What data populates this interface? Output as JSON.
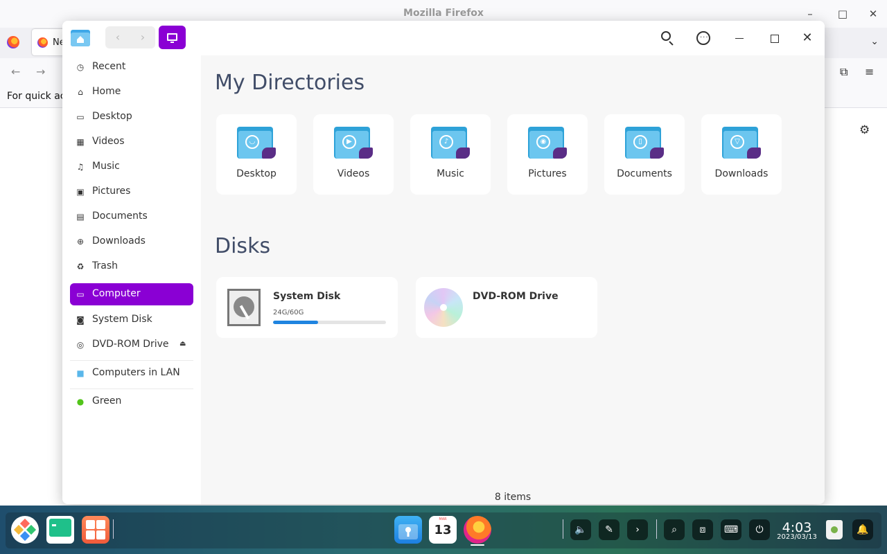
{
  "firefox": {
    "title": "Mozilla Firefox",
    "tab_label": "Ne",
    "bookmarks_text": "For quick acc"
  },
  "file_manager": {
    "sidebar": {
      "items": [
        {
          "label": "Recent",
          "icon": "clock-icon"
        },
        {
          "label": "Home",
          "icon": "home-icon"
        },
        {
          "label": "Desktop",
          "icon": "desktop-icon"
        },
        {
          "label": "Videos",
          "icon": "film-icon"
        },
        {
          "label": "Music",
          "icon": "music-note-icon"
        },
        {
          "label": "Pictures",
          "icon": "image-icon"
        },
        {
          "label": "Documents",
          "icon": "document-icon"
        },
        {
          "label": "Downloads",
          "icon": "download-icon"
        },
        {
          "label": "Trash",
          "icon": "trash-icon"
        },
        {
          "label": "Computer",
          "icon": "monitor-icon",
          "active": true
        },
        {
          "label": "System Disk",
          "icon": "disk-icon"
        },
        {
          "label": "DVD-ROM Drive",
          "icon": "dvd-icon"
        },
        {
          "label": "Computers in LAN",
          "icon": "network-folder-icon"
        },
        {
          "label": "Green",
          "icon": "green-tag-icon"
        }
      ]
    },
    "main": {
      "directories_title": "My Directories",
      "directories": [
        {
          "label": "Desktop",
          "icon": "desktop-folder-icon"
        },
        {
          "label": "Videos",
          "icon": "videos-folder-icon"
        },
        {
          "label": "Music",
          "icon": "music-folder-icon"
        },
        {
          "label": "Pictures",
          "icon": "pictures-folder-icon"
        },
        {
          "label": "Documents",
          "icon": "documents-folder-icon"
        },
        {
          "label": "Downloads",
          "icon": "downloads-folder-icon"
        }
      ],
      "disks_title": "Disks",
      "disks": [
        {
          "name": "System Disk",
          "usage": "24G/60G",
          "used_fraction": 0.4
        },
        {
          "name": "DVD-ROM Drive"
        }
      ],
      "status": "8 items"
    },
    "accent_color": "#8a00d4"
  },
  "dock": {
    "calendar_day": "13",
    "calendar_month": "MAR",
    "clock_time": "4:03",
    "clock_date": "2023/03/13"
  }
}
